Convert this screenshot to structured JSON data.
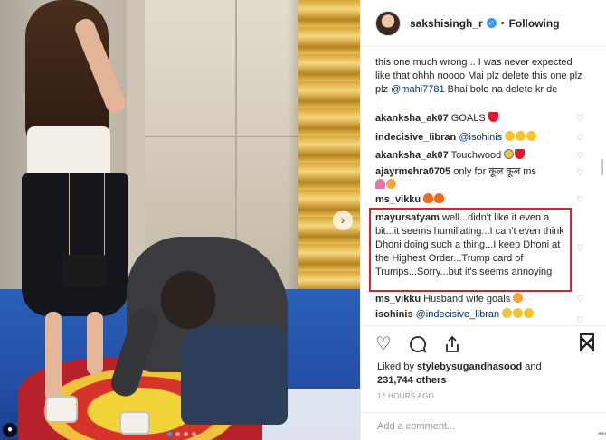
{
  "post": {
    "username": "sakshisingh_r",
    "separator": "•",
    "follow_label": "Following",
    "next_glyph": "›",
    "user_tag_glyph": "👤",
    "carousel_count": 4,
    "carousel_active": 1
  },
  "caption": {
    "line1": "this one much wrong .. I was never expected like that ohhh noooo Mai plz delete this one plz plz ",
    "mention": "@mahi7781",
    "line2": " Bhai bolo na delete kr de"
  },
  "comments": [
    {
      "user": "akanksha_ak07",
      "text": " GOALS ",
      "emojis": [
        "red"
      ]
    },
    {
      "user": "indecisive_libran",
      "mention": "@isohinis",
      "text": " ",
      "emojis": [
        "laugh",
        "laugh",
        "laugh"
      ]
    },
    {
      "user": "akanksha_ak07",
      "text": " Touchwood ",
      "emojis": [
        "cry",
        "red"
      ]
    },
    {
      "user": "ajayrmehra0705",
      "text": " only for कूल कूल ms ",
      "emojis": [
        "tulip",
        "kiss"
      ]
    },
    {
      "user": "ms_vikku",
      "text": " ",
      "emojis": [
        "fire",
        "fire"
      ]
    },
    {
      "user": "mayursatyam",
      "text": " well...didn't like it even a bit...it seems humiliating...I can't even think Dhoni doing such a thing...I keep Dhoni at the Highest Order...Trump card of Trumps...Sorry...but it's seems annoying",
      "emojis": []
    },
    {
      "user": "ms_vikku",
      "text": " Husband wife goals",
      "emojis": [
        "kiss"
      ]
    },
    {
      "user": "isohinis",
      "mention": "@indecisive_libran",
      "text": " ",
      "emojis": [
        "laugh",
        "laugh",
        "laugh"
      ]
    }
  ],
  "footer": {
    "liked_by_prefix": "Liked by ",
    "liked_by_user": "stylebysugandhasood",
    "liked_by_mid": " and",
    "others_count": "231,744 others",
    "timestamp": "12 HOURS AGO",
    "add_comment_placeholder": "Add a comment...",
    "more_glyph": "•••"
  },
  "icons": {
    "heart": "♡",
    "comment": "◯",
    "share": "⇪"
  },
  "colors": {
    "highlight_border": "#e11d28",
    "verified": "#3897f0",
    "mention": "#003569"
  }
}
